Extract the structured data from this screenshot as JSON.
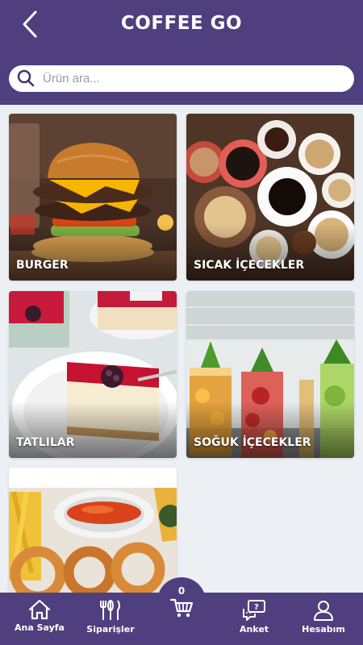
{
  "header": {
    "title": "COFFEE GO",
    "back_icon": "chevron-left-icon"
  },
  "search": {
    "placeholder": "Ürün ara...",
    "icon": "search-icon"
  },
  "categories": [
    {
      "label": "BURGER"
    },
    {
      "label": "SICAK İÇECEKLER"
    },
    {
      "label": "TATLILAR"
    },
    {
      "label": "SOĞUK İÇECEKLER"
    },
    {
      "label": ""
    }
  ],
  "cart": {
    "count": "0",
    "icon": "shopping-cart-icon"
  },
  "bottom_nav": [
    {
      "label": "Ana Sayfa",
      "icon": "home-icon"
    },
    {
      "label": "Siparişler",
      "icon": "cutlery-icon"
    },
    {
      "label": "Anket",
      "icon": "survey-chat-icon"
    },
    {
      "label": "Hesabım",
      "icon": "user-icon"
    }
  ],
  "colors": {
    "brand": "#4f3f7e",
    "background": "#ecf0f4"
  }
}
